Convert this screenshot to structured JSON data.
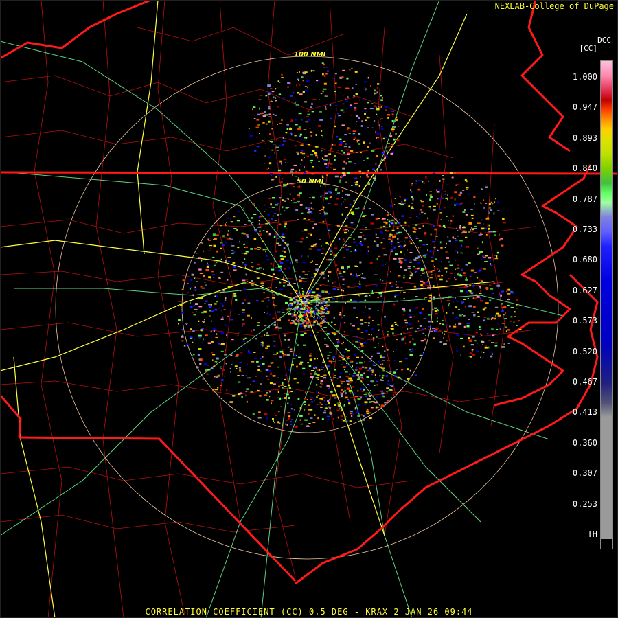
{
  "header": {
    "credit": "NEXLAB-College of DuPage"
  },
  "caption": "CORRELATION COEFFICIENT (CC) 0.5 DEG - KRAX 2 JAN 26 09:44",
  "legend": {
    "product": "DCC",
    "units": "[CC]",
    "ticks": [
      "1.000",
      "0.947",
      "0.893",
      "0.840",
      "0.787",
      "0.733",
      "0.680",
      "0.627",
      "0.573",
      "0.520",
      "0.467",
      "0.413",
      "0.360",
      "0.307",
      "0.253",
      "TH"
    ],
    "colors": {
      "state_border": "#ff1a1a",
      "county_border": "#c01010",
      "interstate": "#ffff40",
      "highway": "#66dd88",
      "range_ring": "#f0c8a0",
      "text": "#ffff33"
    }
  },
  "range_rings": [
    "50 NMI",
    "100 NMI"
  ],
  "radar": {
    "site": "KRAX",
    "elevation": "0.5 DEG"
  }
}
